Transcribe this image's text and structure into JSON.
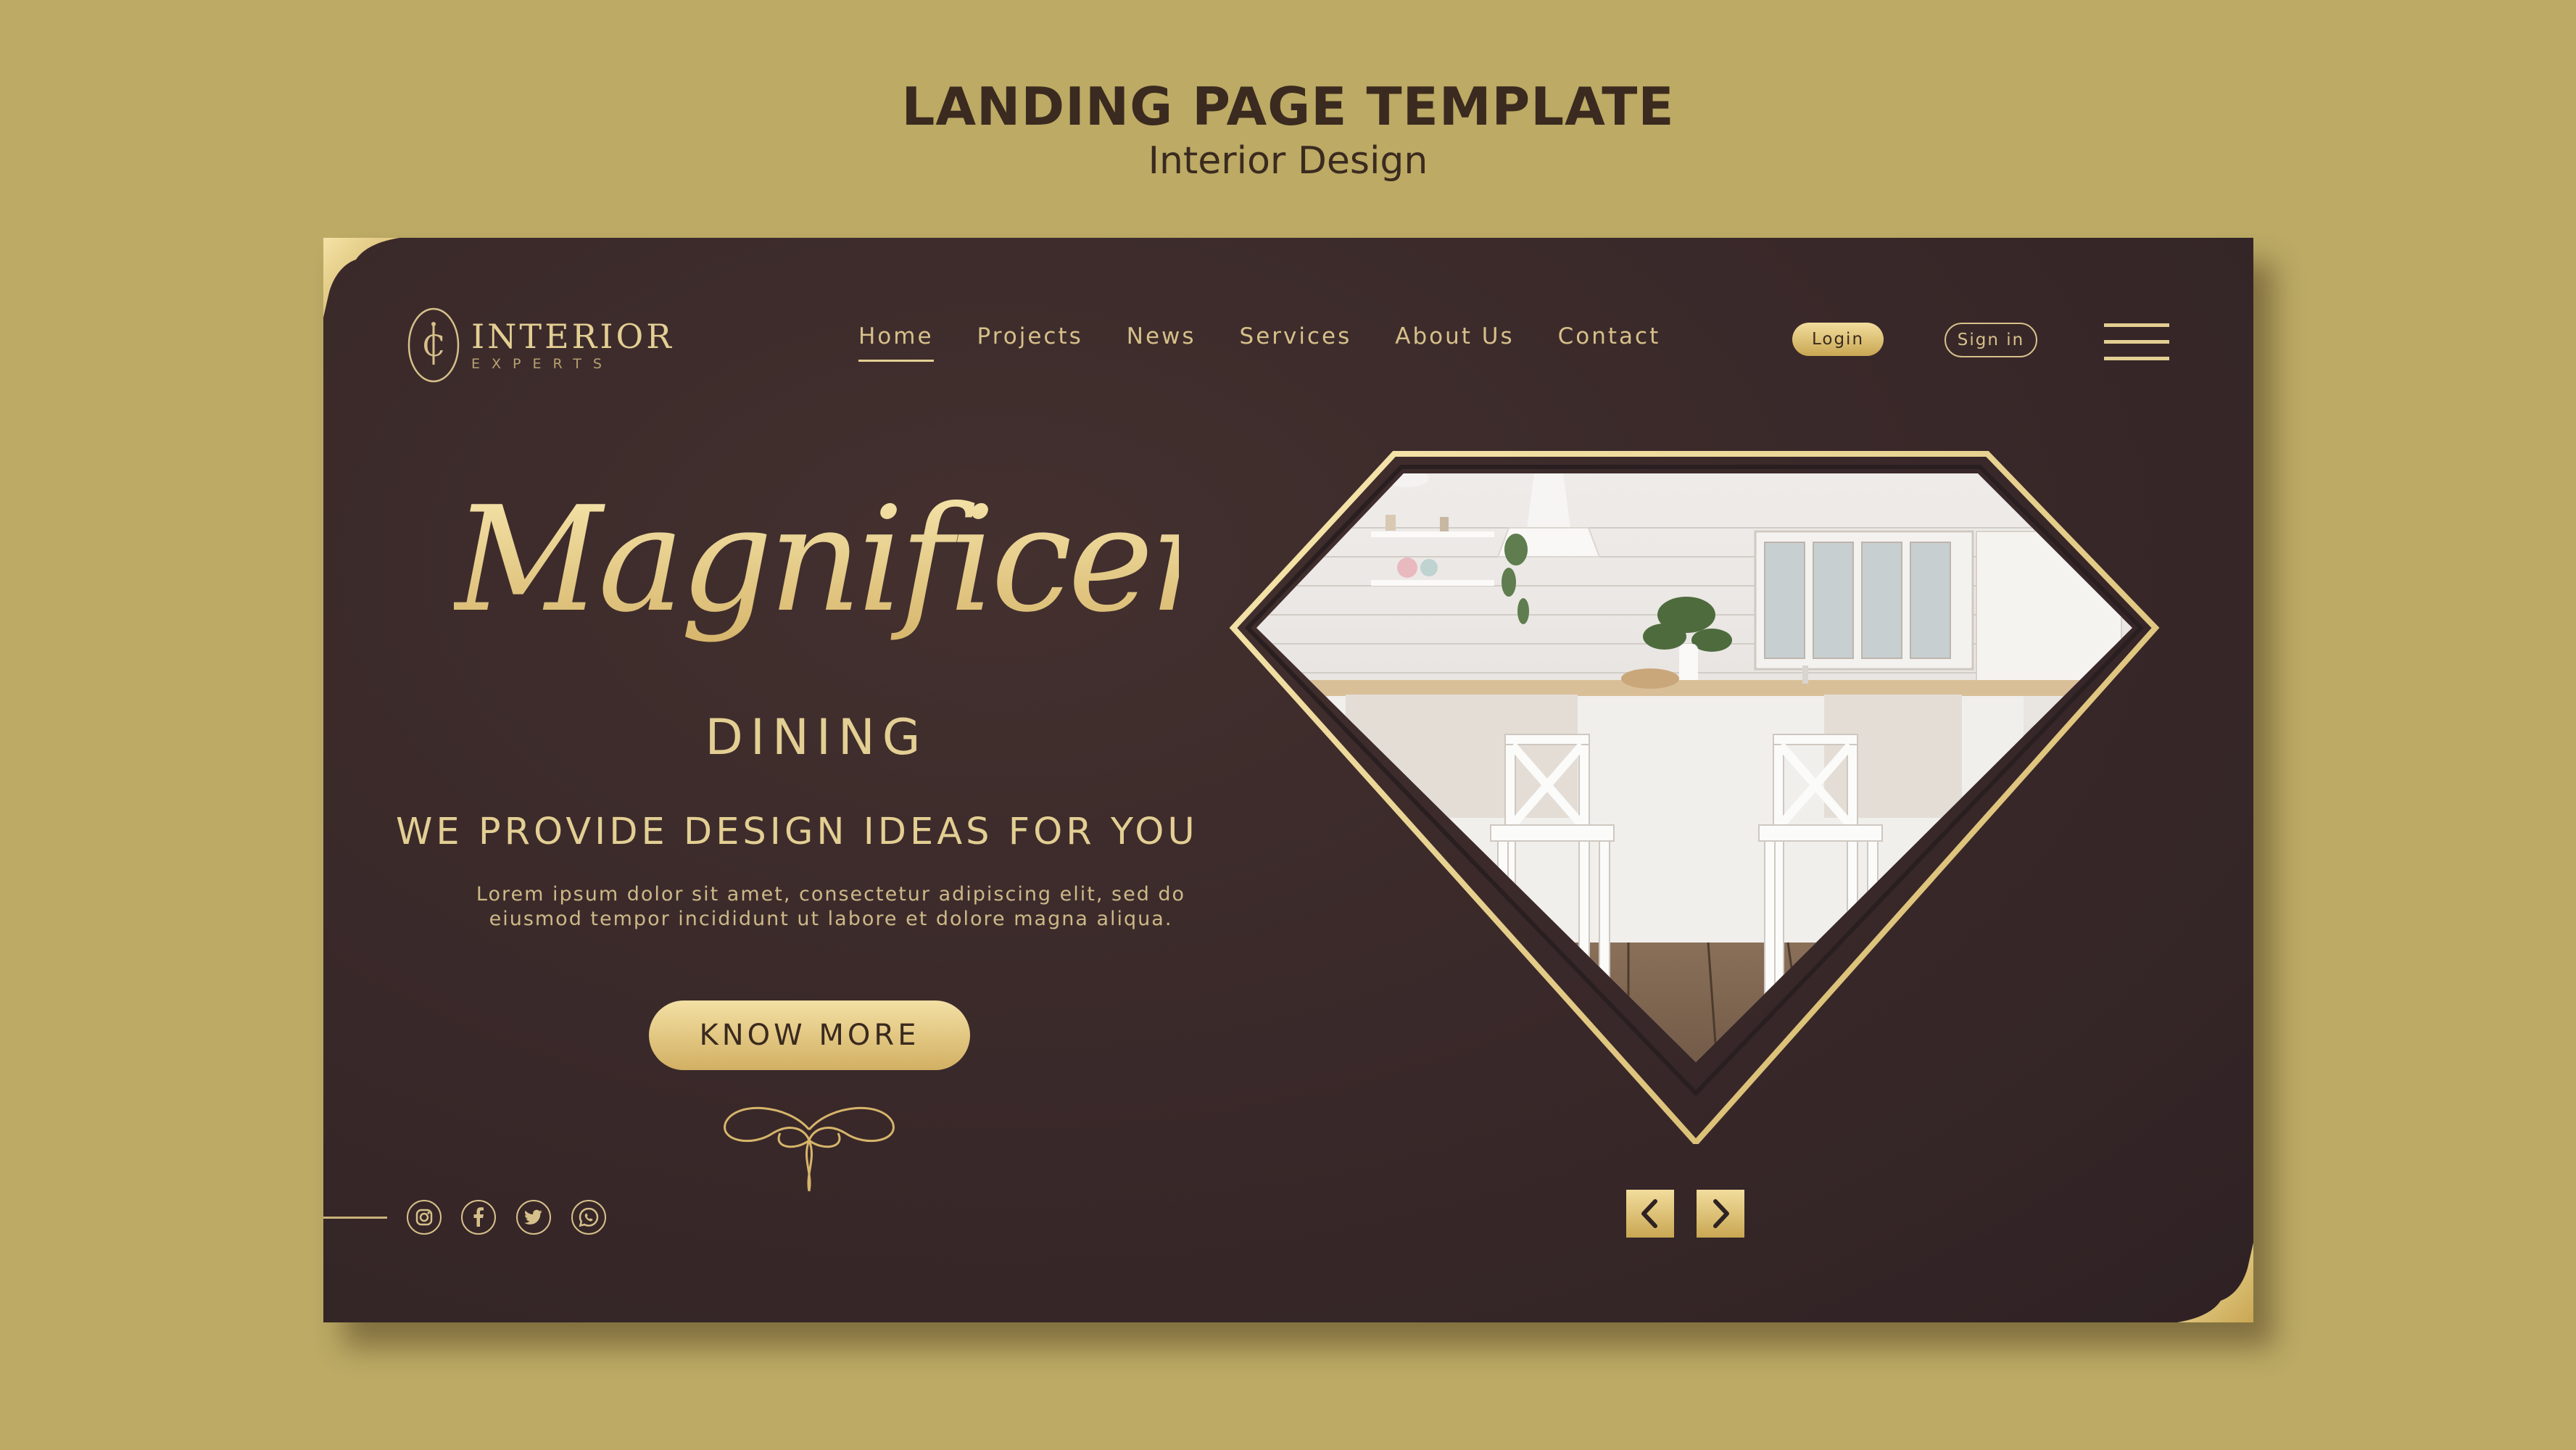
{
  "header": {
    "title": "LANDING PAGE TEMPLATE",
    "subtitle": "Interior Design"
  },
  "brand": {
    "name": "INTERIOR",
    "tagline": "EXPERTS",
    "monogram": "IC"
  },
  "nav": {
    "items": [
      {
        "label": "Home",
        "active": true
      },
      {
        "label": "Projects"
      },
      {
        "label": "News"
      },
      {
        "label": "Services"
      },
      {
        "label": "About Us"
      },
      {
        "label": "Contact"
      }
    ]
  },
  "auth": {
    "login_label": "Login",
    "signin_label": "Sign in"
  },
  "hero": {
    "script_title": "Magnificent",
    "subtitle": "DINING",
    "tagline": "WE PROVIDE DESIGN IDEAS FOR YOU",
    "body_line1": "Lorem ipsum dolor sit amet, consectetur adipiscing elit, sed do",
    "body_line2": "eiusmod tempor incididunt ut labore et dolore magna aliqua.",
    "cta_label": "KNOW MORE"
  },
  "social": {
    "icons": [
      "instagram-icon",
      "facebook-icon",
      "twitter-icon",
      "whatsapp-icon"
    ]
  },
  "slider": {
    "prev_icon": "chevron-left-icon",
    "next_icon": "chevron-right-icon"
  },
  "colors": {
    "background": "#bcaa65",
    "card": "#3a2a2b",
    "gold": "#e3cf93",
    "gold_dark": "#c9a753",
    "text_dark": "#3a2a1f"
  }
}
